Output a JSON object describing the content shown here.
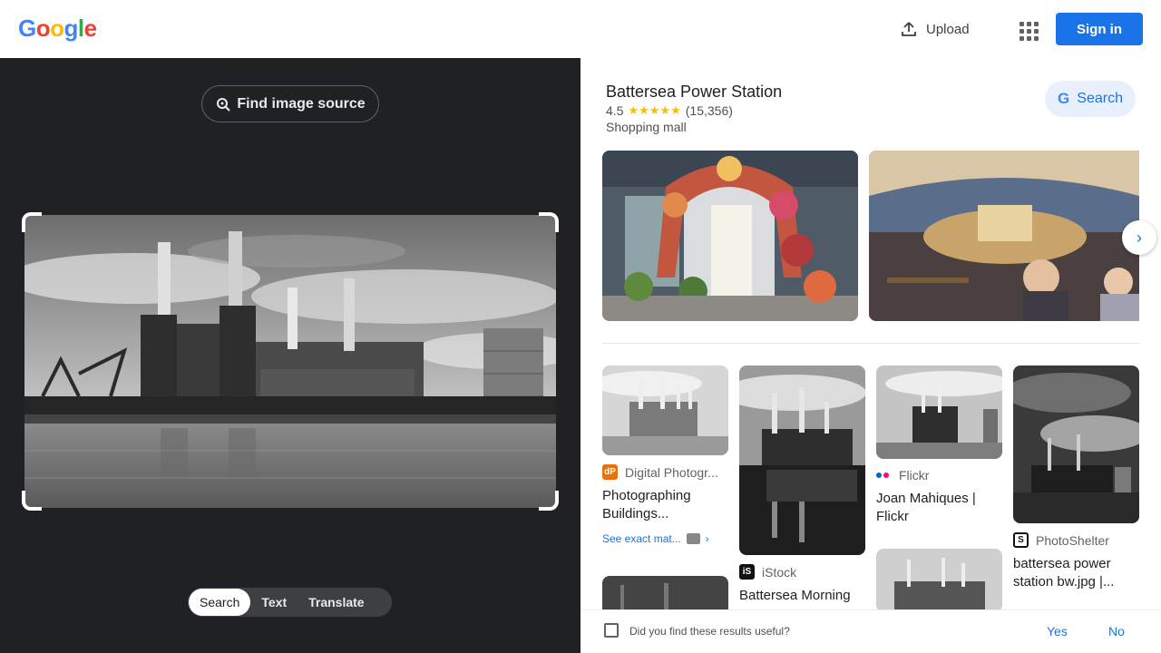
{
  "header": {
    "logo": [
      "G",
      "o",
      "o",
      "g",
      "l",
      "e"
    ],
    "logo_colors": [
      "#4285f4",
      "#ea4335",
      "#fbbc05",
      "#4285f4",
      "#34a853",
      "#ea4335"
    ],
    "upload_label": "Upload",
    "signin_label": "Sign in"
  },
  "lens": {
    "find_source_label": "Find image source",
    "modes": [
      "Search",
      "Text",
      "Translate"
    ],
    "active_mode": "Search"
  },
  "place": {
    "name": "Battersea Power Station",
    "rating": "4.5",
    "stars": "★★★★★",
    "reviews": "(15,356)",
    "category": "Shopping mall",
    "search_label": "Search",
    "search_g": "G"
  },
  "results": [
    {
      "source": "Digital Photogr...",
      "favicon": "dP",
      "favicon_color": "#e8710a",
      "title": "Photographing Buildings...",
      "exact_label": "See exact mat..."
    },
    {
      "source": "iStock",
      "favicon": "iS",
      "favicon_color": "#111111",
      "title": "Battersea Morning"
    },
    {
      "source": "Flickr",
      "title": "Joan Mahiques | Flickr"
    },
    {
      "source": "PhotoShelter",
      "favicon": "S",
      "favicon_color": "#111111",
      "title": "battersea power station bw.jpg |..."
    }
  ],
  "feedback": {
    "question": "Did you find these results useful?",
    "yes": "Yes",
    "no": "No"
  },
  "colors": {
    "accent": "#1a73e8",
    "dark_pane": "#202124",
    "star": "#fbbc04"
  }
}
